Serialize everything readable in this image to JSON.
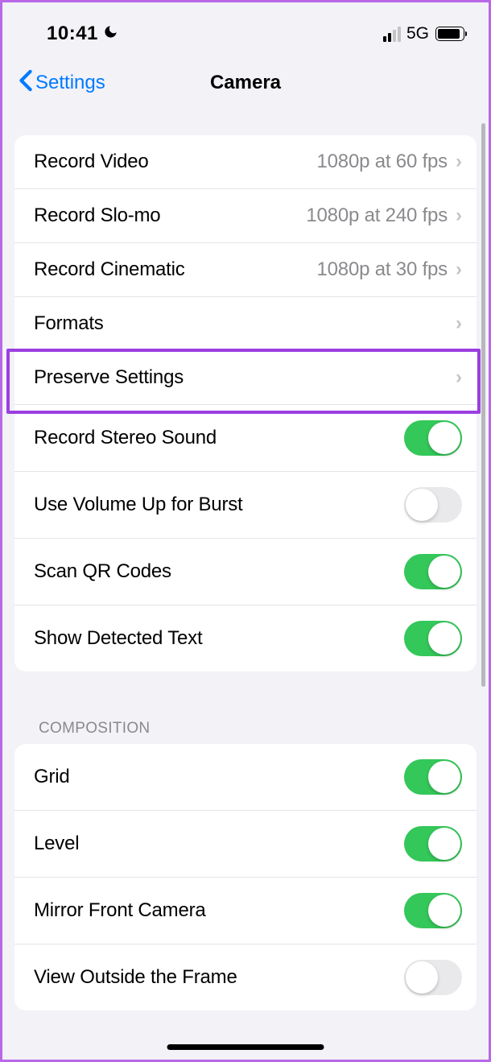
{
  "status": {
    "time": "10:41",
    "network": "5G"
  },
  "nav": {
    "back": "Settings",
    "title": "Camera"
  },
  "mainSection": {
    "rows": [
      {
        "label": "Record Video",
        "value": "1080p at 60 fps",
        "type": "disclosure"
      },
      {
        "label": "Record Slo-mo",
        "value": "1080p at 240 fps",
        "type": "disclosure"
      },
      {
        "label": "Record Cinematic",
        "value": "1080p at 30 fps",
        "type": "disclosure"
      },
      {
        "label": "Formats",
        "value": "",
        "type": "disclosure"
      },
      {
        "label": "Preserve Settings",
        "value": "",
        "type": "disclosure"
      },
      {
        "label": "Record Stereo Sound",
        "on": true,
        "type": "toggle"
      },
      {
        "label": "Use Volume Up for Burst",
        "on": false,
        "type": "toggle"
      },
      {
        "label": "Scan QR Codes",
        "on": true,
        "type": "toggle"
      },
      {
        "label": "Show Detected Text",
        "on": true,
        "type": "toggle"
      }
    ]
  },
  "compositionSection": {
    "header": "COMPOSITION",
    "rows": [
      {
        "label": "Grid",
        "on": true,
        "type": "toggle"
      },
      {
        "label": "Level",
        "on": true,
        "type": "toggle"
      },
      {
        "label": "Mirror Front Camera",
        "on": true,
        "type": "toggle"
      },
      {
        "label": "View Outside the Frame",
        "on": false,
        "type": "toggle"
      }
    ]
  }
}
